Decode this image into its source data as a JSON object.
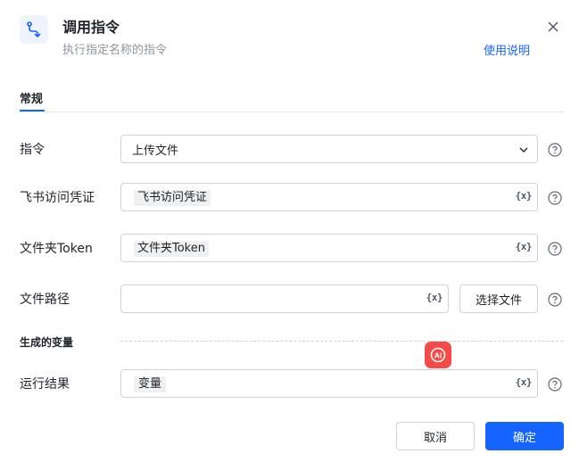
{
  "dialog": {
    "title": "调用指令",
    "subtitle": "执行指定名称的指令",
    "help_link": "使用说明"
  },
  "tabs": [
    {
      "label": "常规",
      "active": true
    }
  ],
  "fields": {
    "command": {
      "label": "指令",
      "value": "上传文件"
    },
    "credential": {
      "label": "飞书访问凭证",
      "value": "飞书访问凭证"
    },
    "folder_token": {
      "label": "文件夹Token",
      "value": "文件夹Token"
    },
    "file_path": {
      "label": "文件路径",
      "value": "",
      "button": "选择文件"
    }
  },
  "variables_section": {
    "title": "生成的变量",
    "result": {
      "label": "运行结果",
      "value": "变量"
    }
  },
  "var_icon_text": "{x}",
  "ai_label": "AI",
  "footer": {
    "cancel": "取消",
    "confirm": "确定"
  },
  "colors": {
    "accent": "#1664ff",
    "ai": "#f54a45"
  }
}
